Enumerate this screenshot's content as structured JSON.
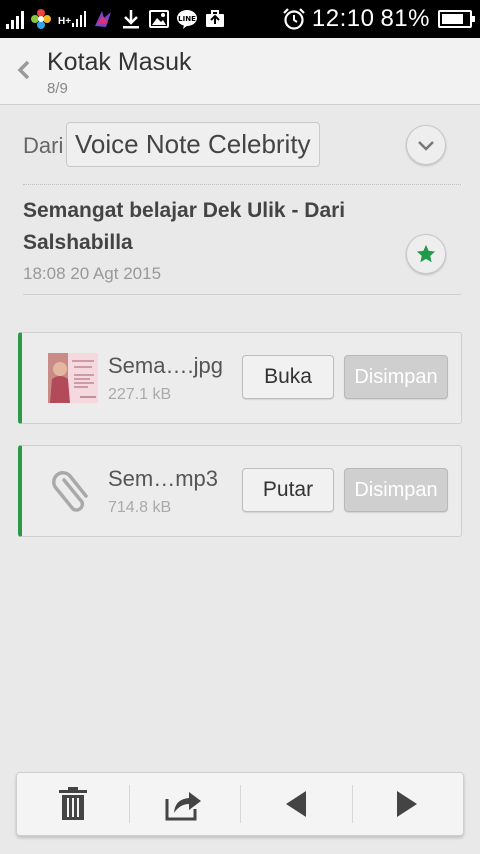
{
  "status_bar": {
    "network_type": "H+",
    "time": "12:10",
    "battery_percent": "81%",
    "battery_level": 0.81,
    "icons": [
      "signal-icon",
      "flower-app-icon",
      "signal-h-plus-icon",
      "game-app-icon",
      "download-icon",
      "image-icon",
      "line-app-icon",
      "briefcase-icon",
      "alarm-icon",
      "battery-icon"
    ]
  },
  "header": {
    "title": "Kotak Masuk",
    "counter": "8/9"
  },
  "message": {
    "from_label": "Dari",
    "sender": "Voice Note Celebrity",
    "subject": "Semangat belajar Dek Ulik - Dari Salshabilla",
    "timestamp": "18:08 20 Agt 2015",
    "starred": true
  },
  "attachments": [
    {
      "name": "Sema….jpg",
      "size": "227.1 kB",
      "action_label": "Buka",
      "save_label": "Disimpan",
      "icon": "image-thumbnail"
    },
    {
      "name": "Sem…mp3",
      "size": "714.8 kB",
      "action_label": "Putar",
      "save_label": "Disimpan",
      "icon": "paperclip-icon"
    }
  ],
  "toolbar": {
    "icons": [
      "trash-icon",
      "forward-icon",
      "previous-icon",
      "next-icon"
    ]
  },
  "colors": {
    "accent_green": "#2a9a4a",
    "star_green": "#1f9a4a",
    "background": "#e9e9e9",
    "status_bar": "#000000"
  }
}
